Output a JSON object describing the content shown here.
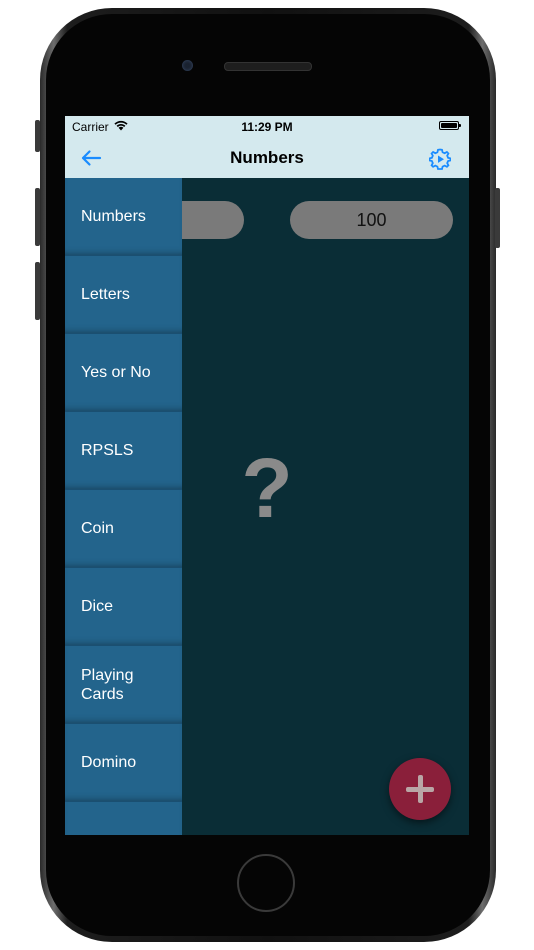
{
  "status_bar": {
    "carrier": "Carrier",
    "time": "11:29 PM"
  },
  "nav": {
    "title": "Numbers",
    "back_icon": "arrow-left-icon",
    "settings_icon": "gear-play-icon"
  },
  "range": {
    "min_value": "",
    "max_value": "100"
  },
  "result": {
    "text": "?"
  },
  "sidebar": {
    "items": [
      {
        "label": "Numbers"
      },
      {
        "label": "Letters"
      },
      {
        "label": "Yes or No"
      },
      {
        "label": "RPSLS"
      },
      {
        "label": "Coin"
      },
      {
        "label": "Dice"
      },
      {
        "label": "Playing\nCards"
      },
      {
        "label": "Domino"
      },
      {
        "label": ""
      }
    ]
  },
  "fab": {
    "icon": "plus-icon"
  },
  "colors": {
    "nav_background": "#d4e9ee",
    "accent": "#1a8cff",
    "sidebar": "#23648c",
    "content_background": "#0a2d36",
    "pill": "#7a7a7a",
    "fab": "#8a1f3a"
  }
}
